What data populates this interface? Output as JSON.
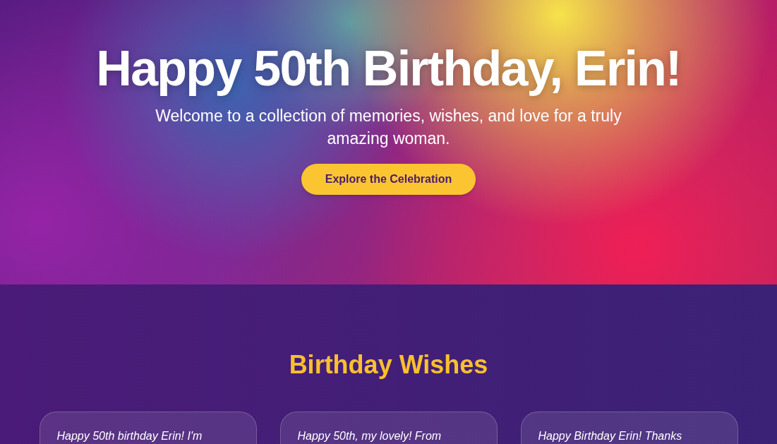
{
  "hero": {
    "title": "Happy 50th Birthday, Erin!",
    "subtitle": "Welcome to a collection of memories, wishes, and love for a truly amazing woman.",
    "button": "Explore the Celebration"
  },
  "wishes": {
    "heading": "Birthday Wishes",
    "cards": [
      {
        "text": "Happy 50th birthday Erin! I'm"
      },
      {
        "text": "Happy 50th, my lovely! From"
      },
      {
        "text": "Happy Birthday Erin! Thanks"
      }
    ]
  }
}
